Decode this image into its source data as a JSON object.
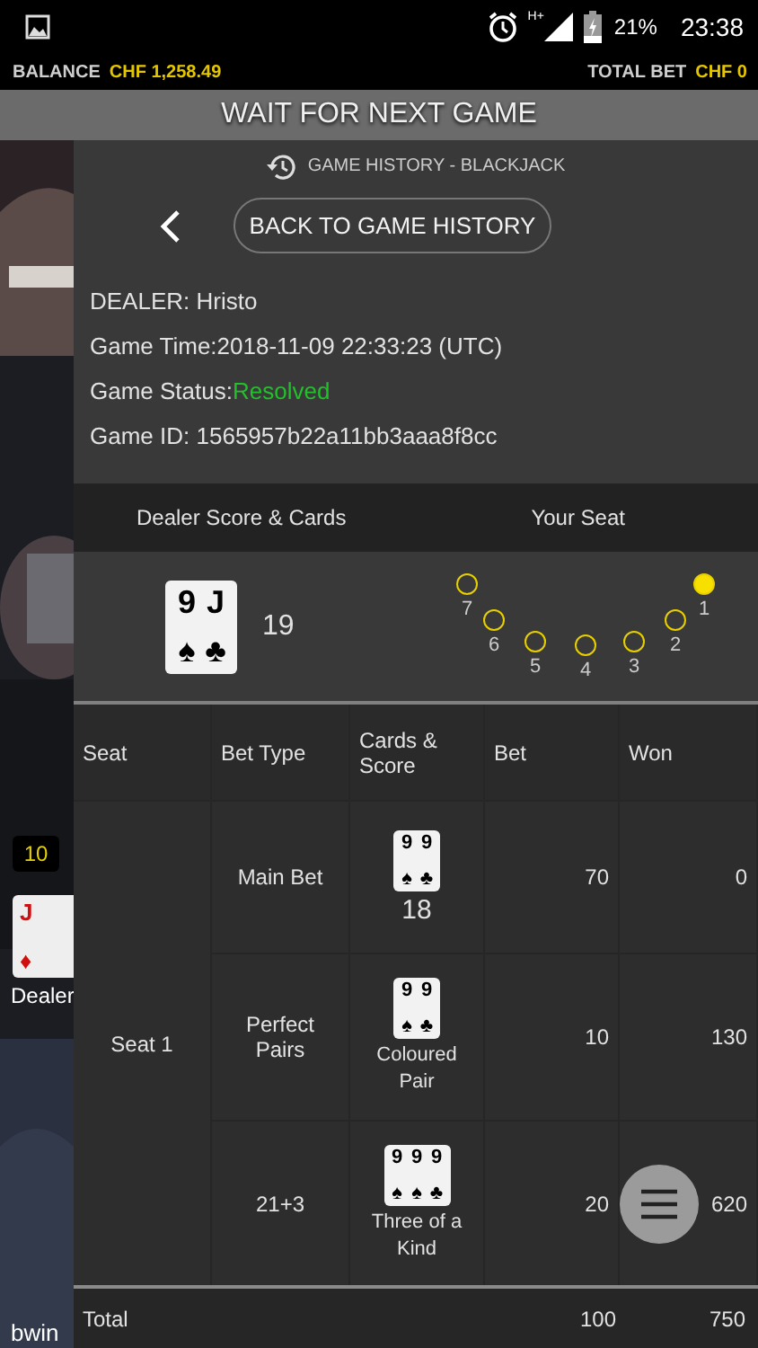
{
  "status_bar": {
    "network": "H+",
    "battery": "21%",
    "time": "23:38"
  },
  "balance_bar": {
    "balance_label": "BALANCE",
    "balance": "CHF 1,258.49",
    "total_bet_label": "TOTAL BET",
    "total_bet": "CHF 0"
  },
  "banner": "WAIT FOR NEXT GAME",
  "background": {
    "kind": "picture",
    "score_badge": "10",
    "card": {
      "rank": "J",
      "suit": "♦"
    },
    "dealer_label": "Dealer",
    "brand": "bwin"
  },
  "panel": {
    "title": "GAME HISTORY - BLACKJACK",
    "back_button": "BACK TO GAME HISTORY",
    "info": [
      {
        "kind": "plain",
        "label": "DEALER: ",
        "value": "Hristo"
      },
      {
        "kind": "plain",
        "label": "Game Time:",
        "value": "2018-11-09 22:33:23 (UTC)"
      },
      {
        "kind": "status",
        "label": "Game Status:",
        "value": "Resolved"
      },
      {
        "kind": "plain",
        "label": "Game ID: ",
        "value": "1565957b22a11bb3aaa8f8cc"
      }
    ],
    "summary_headers": [
      "Dealer Score & Cards",
      "Your Seat"
    ],
    "dealer": {
      "cards": [
        {
          "rank": "9",
          "suit": "♠"
        },
        {
          "rank": "J",
          "suit": "♣"
        }
      ],
      "score": "19"
    },
    "seats": [
      {
        "label": "7",
        "selected": false
      },
      {
        "label": "6",
        "selected": false
      },
      {
        "label": "5",
        "selected": false
      },
      {
        "label": "4",
        "selected": false
      },
      {
        "label": "3",
        "selected": false
      },
      {
        "label": "2",
        "selected": false
      },
      {
        "label": "1",
        "selected": true
      }
    ],
    "table": {
      "columns": [
        "Seat",
        "Bet Type",
        "Cards & Score",
        "Bet",
        "Won"
      ],
      "seat": "Seat 1",
      "rows": [
        {
          "bet_type": "Main Bet",
          "cards": [
            {
              "rank": "9",
              "suit": "♠"
            },
            {
              "rank": "9",
              "suit": "♣"
            }
          ],
          "kind": "score",
          "result": "18",
          "bet": "70",
          "won": "0"
        },
        {
          "bet_type": "Perfect Pairs",
          "cards": [
            {
              "rank": "9",
              "suit": "♠"
            },
            {
              "rank": "9",
              "suit": "♣"
            }
          ],
          "kind": "hand",
          "result": "Coloured Pair",
          "bet": "10",
          "won": "130"
        },
        {
          "bet_type": "21+3",
          "cards": [
            {
              "rank": "9",
              "suit": "♠"
            },
            {
              "rank": "9",
              "suit": "♠"
            },
            {
              "rank": "9",
              "suit": "♣"
            }
          ],
          "kind": "hand",
          "result": "Three of a Kind",
          "bet": "20",
          "won": "620"
        }
      ],
      "total": {
        "label": "Total",
        "bet": "100",
        "won": "750"
      }
    }
  }
}
